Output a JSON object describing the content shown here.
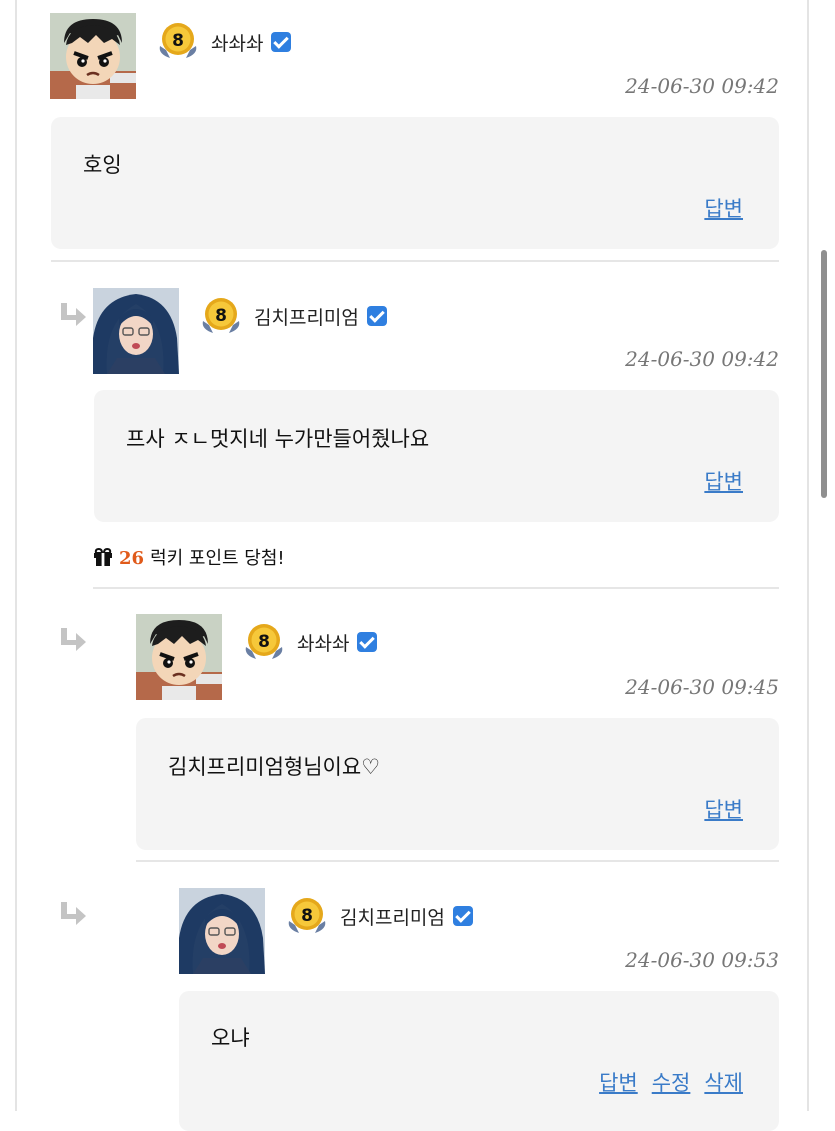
{
  "comments": [
    {
      "username": "솨솨솨",
      "level": "8",
      "timestamp": "24-06-30 09:42",
      "text": "호잉",
      "actions": [
        "답변"
      ]
    },
    {
      "username": "김치프리미엄",
      "level": "8",
      "timestamp": "24-06-30 09:42",
      "text": "프사 ㅈㄴ멋지네 누가만들어줬나요",
      "actions": [
        "답변"
      ]
    },
    {
      "username": "솨솨솨",
      "level": "8",
      "timestamp": "24-06-30 09:45",
      "text": "김치프리미엄형님이요♡",
      "actions": [
        "답변"
      ]
    },
    {
      "username": "김치프리미엄",
      "level": "8",
      "timestamp": "24-06-30 09:53",
      "text": "오냐",
      "actions": [
        "답변",
        "수정",
        "삭제"
      ]
    }
  ],
  "lucky_point": {
    "amount": "26",
    "text": "럭키 포인트 당첨!"
  },
  "colors": {
    "link": "#3a7bc8",
    "verified": "#2f7fe0",
    "lucky_number": "#e05a1a",
    "bubble": "#f4f4f4"
  },
  "icons": [
    "verified-check-icon",
    "level-badge-icon",
    "reply-arrow-icon",
    "gift-icon"
  ]
}
